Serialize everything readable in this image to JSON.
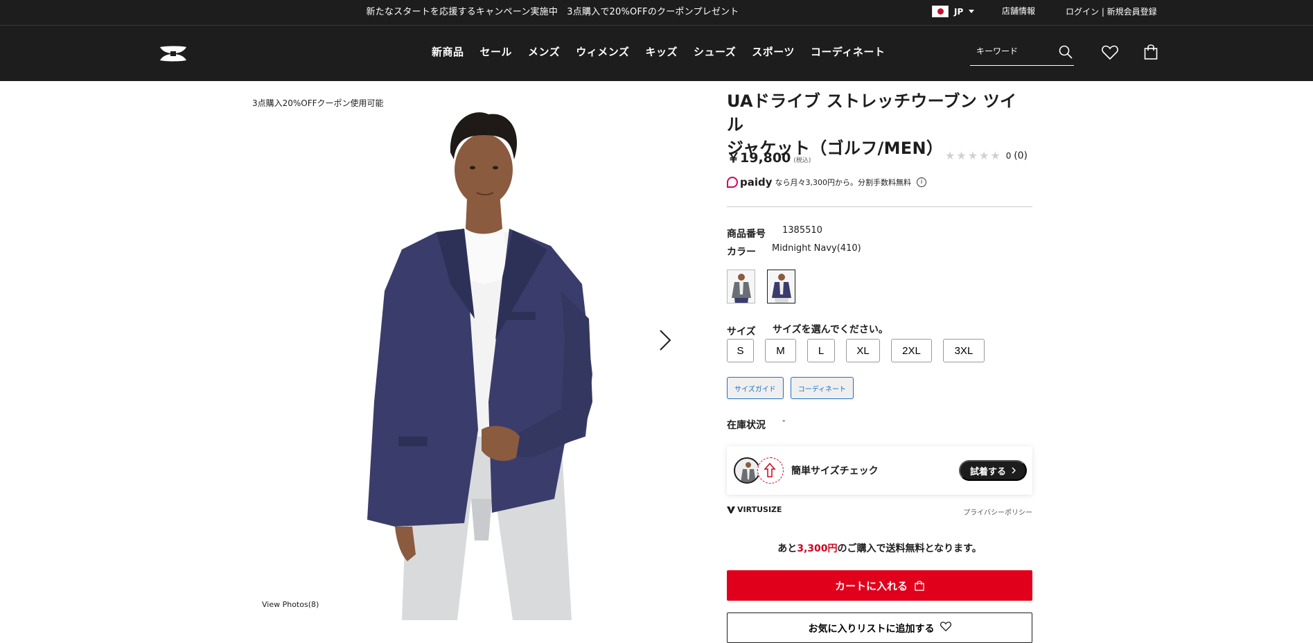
{
  "promo": {
    "text": "新たなスタートを応援するキャンペーン実施中　3点購入で20%OFFのクーポンプレゼント",
    "locale": "JP",
    "store": "店舗情報",
    "auth": "ログイン | 新規会員登録"
  },
  "header": {
    "nav": [
      "新商品",
      "セール",
      "メンズ",
      "ウィメンズ",
      "キッズ",
      "シューズ",
      "スポーツ",
      "コーディネート"
    ],
    "search_placeholder": "キーワード"
  },
  "gallery": {
    "coupon_note": "3点購入20%OFFクーポン使用可能",
    "view_photos": "View Photos(8)"
  },
  "product": {
    "title_line1": "UAドライブ ストレッチウーブン ツイル",
    "title_line2": "ジャケット（ゴルフ/MEN）",
    "price": "￥19,800",
    "tax": "(税込)",
    "rating_score": "0",
    "rating_count": "(0)",
    "paidy_brand": "paidy",
    "paidy_text": "なら月々3,300円から。分割手数料無料",
    "sku_label": "商品番号",
    "sku": "1385510",
    "color_label": "カラー",
    "color": "Midnight Navy(410)",
    "size_label": "サイズ",
    "size_hint": "サイズを選んでください。",
    "sizes": [
      "S",
      "M",
      "L",
      "XL",
      "2XL",
      "3XL"
    ],
    "size_guide": "サイズガイド",
    "coordinate": "コーディネート",
    "stock_label": "在庫状況",
    "stock_value": "-"
  },
  "virtusize": {
    "title": "簡単サイズチェック",
    "try_button": "試着する",
    "brand": "VIRTUSIZE",
    "privacy": "プライバシーポリシー"
  },
  "purchase": {
    "shipping_prefix": "あと",
    "shipping_amount": "3,300円",
    "shipping_suffix": "のご購入で送料無料となります。",
    "cart_button": "カートに入れる",
    "wishlist_button": "お気に入りリストに追加する"
  },
  "colors": {
    "jacket": "#3a3d6b",
    "accent_red": "#e0001b",
    "link_blue": "#1a6fc4"
  }
}
